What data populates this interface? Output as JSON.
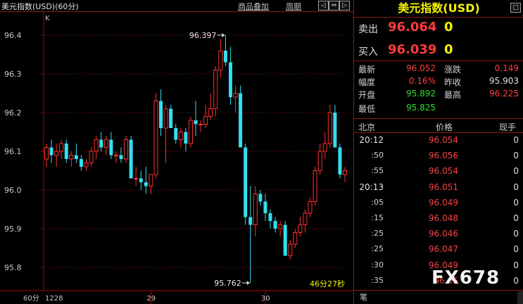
{
  "header": {
    "title": "美元指数(USD)(60分)",
    "tools": [
      "商品叠加",
      "周期"
    ],
    "nav_icons": [
      "arrow-left-icon",
      "arrows-expand-icon",
      "arrow-right-icon",
      "window-icon"
    ]
  },
  "chart": {
    "corner_label": "K",
    "period_label": "60分",
    "y_ticks": [
      "96.4",
      "96.3",
      "96.2",
      "96.1",
      "96.0",
      "95.9",
      "95.8"
    ],
    "x_ticks": [
      "1228",
      "29",
      "30"
    ],
    "high_annotation": "96.397",
    "low_annotation": "95.762",
    "countdown": "46分27秒",
    "colors": {
      "up": "#ff3030",
      "down": "#30e0f0",
      "grid": "#7a0d0d",
      "axis": "#b00000"
    }
  },
  "chart_data": {
    "type": "candlestick",
    "y_range": [
      95.74,
      96.46
    ],
    "x_tick_positions": [
      "1228",
      "29",
      "30"
    ],
    "candles": [
      {
        "o": 96.08,
        "h": 96.12,
        "l": 96.06,
        "c": 96.11
      },
      {
        "o": 96.11,
        "h": 96.13,
        "l": 96.07,
        "c": 96.09
      },
      {
        "o": 96.09,
        "h": 96.12,
        "l": 96.06,
        "c": 96.1
      },
      {
        "o": 96.1,
        "h": 96.13,
        "l": 96.08,
        "c": 96.12
      },
      {
        "o": 96.12,
        "h": 96.13,
        "l": 96.07,
        "c": 96.08
      },
      {
        "o": 96.08,
        "h": 96.1,
        "l": 96.06,
        "c": 96.09
      },
      {
        "o": 96.09,
        "h": 96.12,
        "l": 96.07,
        "c": 96.08
      },
      {
        "o": 96.08,
        "h": 96.09,
        "l": 96.05,
        "c": 96.06
      },
      {
        "o": 96.06,
        "h": 96.08,
        "l": 96.05,
        "c": 96.07
      },
      {
        "o": 96.07,
        "h": 96.11,
        "l": 96.06,
        "c": 96.1
      },
      {
        "o": 96.1,
        "h": 96.14,
        "l": 96.08,
        "c": 96.13
      },
      {
        "o": 96.13,
        "h": 96.15,
        "l": 96.1,
        "c": 96.11
      },
      {
        "o": 96.11,
        "h": 96.14,
        "l": 96.09,
        "c": 96.13
      },
      {
        "o": 96.13,
        "h": 96.15,
        "l": 96.08,
        "c": 96.09
      },
      {
        "o": 96.09,
        "h": 96.1,
        "l": 96.07,
        "c": 96.09
      },
      {
        "o": 96.09,
        "h": 96.11,
        "l": 96.07,
        "c": 96.08
      },
      {
        "o": 96.08,
        "h": 96.14,
        "l": 96.07,
        "c": 96.13
      },
      {
        "o": 96.13,
        "h": 96.14,
        "l": 96.03,
        "c": 96.03
      },
      {
        "o": 96.03,
        "h": 96.06,
        "l": 96.01,
        "c": 96.03
      },
      {
        "o": 96.03,
        "h": 96.05,
        "l": 96.0,
        "c": 96.02
      },
      {
        "o": 96.02,
        "h": 96.06,
        "l": 95.99,
        "c": 96.01
      },
      {
        "o": 96.01,
        "h": 96.04,
        "l": 95.99,
        "c": 96.04
      },
      {
        "o": 96.04,
        "h": 96.25,
        "l": 96.03,
        "c": 96.23
      },
      {
        "o": 96.23,
        "h": 96.26,
        "l": 96.14,
        "c": 96.16
      },
      {
        "o": 96.16,
        "h": 96.22,
        "l": 96.07,
        "c": 96.21
      },
      {
        "o": 96.21,
        "h": 96.22,
        "l": 96.16,
        "c": 96.16
      },
      {
        "o": 96.16,
        "h": 96.17,
        "l": 96.12,
        "c": 96.13
      },
      {
        "o": 96.13,
        "h": 96.16,
        "l": 96.11,
        "c": 96.15
      },
      {
        "o": 96.15,
        "h": 96.16,
        "l": 96.1,
        "c": 96.12
      },
      {
        "o": 96.12,
        "h": 96.19,
        "l": 96.11,
        "c": 96.18
      },
      {
        "o": 96.18,
        "h": 96.23,
        "l": 96.14,
        "c": 96.17
      },
      {
        "o": 96.17,
        "h": 96.18,
        "l": 96.15,
        "c": 96.17
      },
      {
        "o": 96.17,
        "h": 96.22,
        "l": 96.16,
        "c": 96.19
      },
      {
        "o": 96.19,
        "h": 96.25,
        "l": 96.18,
        "c": 96.21
      },
      {
        "o": 96.21,
        "h": 96.32,
        "l": 96.19,
        "c": 96.31
      },
      {
        "o": 96.31,
        "h": 96.39,
        "l": 96.29,
        "c": 96.36
      },
      {
        "o": 96.36,
        "h": 96.4,
        "l": 96.32,
        "c": 96.33
      },
      {
        "o": 96.33,
        "h": 96.37,
        "l": 96.22,
        "c": 96.24
      },
      {
        "o": 96.24,
        "h": 96.27,
        "l": 96.2,
        "c": 96.25
      },
      {
        "o": 96.25,
        "h": 96.27,
        "l": 96.11,
        "c": 96.11
      },
      {
        "o": 96.11,
        "h": 96.12,
        "l": 95.91,
        "c": 95.93
      },
      {
        "o": 95.93,
        "h": 96.01,
        "l": 95.76,
        "c": 95.91
      },
      {
        "o": 95.91,
        "h": 96.01,
        "l": 95.88,
        "c": 95.99
      },
      {
        "o": 95.99,
        "h": 96.0,
        "l": 95.96,
        "c": 95.97
      },
      {
        "o": 95.97,
        "h": 95.99,
        "l": 95.92,
        "c": 95.94
      },
      {
        "o": 95.94,
        "h": 95.95,
        "l": 95.9,
        "c": 95.92
      },
      {
        "o": 95.92,
        "h": 95.93,
        "l": 95.89,
        "c": 95.9
      },
      {
        "o": 95.9,
        "h": 95.92,
        "l": 95.88,
        "c": 95.91
      },
      {
        "o": 95.91,
        "h": 95.92,
        "l": 95.83,
        "c": 95.83
      },
      {
        "o": 95.83,
        "h": 95.87,
        "l": 95.82,
        "c": 95.86
      },
      {
        "o": 95.86,
        "h": 95.9,
        "l": 95.85,
        "c": 95.89
      },
      {
        "o": 95.89,
        "h": 95.93,
        "l": 95.88,
        "c": 95.91
      },
      {
        "o": 95.91,
        "h": 95.95,
        "l": 95.89,
        "c": 95.94
      },
      {
        "o": 95.94,
        "h": 95.98,
        "l": 95.93,
        "c": 95.97
      },
      {
        "o": 95.97,
        "h": 96.06,
        "l": 95.96,
        "c": 96.05
      },
      {
        "o": 96.05,
        "h": 96.12,
        "l": 96.04,
        "c": 96.1
      },
      {
        "o": 96.1,
        "h": 96.15,
        "l": 96.08,
        "c": 96.12
      },
      {
        "o": 96.12,
        "h": 96.22,
        "l": 96.11,
        "c": 96.2
      },
      {
        "o": 96.2,
        "h": 96.22,
        "l": 96.11,
        "c": 96.11
      },
      {
        "o": 96.11,
        "h": 96.12,
        "l": 96.03,
        "c": 96.04
      },
      {
        "o": 96.04,
        "h": 96.06,
        "l": 96.02,
        "c": 96.05
      }
    ]
  },
  "panel": {
    "title": "美元指数(USD)",
    "sell_label": "卖出",
    "sell_price": "96.064",
    "sell_vol": "0",
    "buy_label": "买入",
    "buy_price": "96.039",
    "buy_vol": "0",
    "stats": [
      {
        "label": "最新",
        "value": "96.052",
        "color": "#ff4040"
      },
      {
        "label": "涨跌",
        "value": "0.149",
        "color": "#ff4040"
      },
      {
        "label": "幅度",
        "value": "0.16%",
        "color": "#ff4040"
      },
      {
        "label": "昨收",
        "value": "95.903",
        "color": "#e0e0e0"
      },
      {
        "label": "开盘",
        "value": "95.892",
        "color": "#30e030"
      },
      {
        "label": "最高",
        "value": "96.225",
        "color": "#ff4040"
      },
      {
        "label": "最低",
        "value": "95.825",
        "color": "#30e030"
      }
    ],
    "tick_headers": [
      "北京",
      "价格",
      "现手"
    ],
    "ticks": [
      {
        "time": "20:12",
        "price": "96.054",
        "vol": "0",
        "major": true
      },
      {
        "time": ":50",
        "price": "96.056",
        "vol": "0",
        "major": false
      },
      {
        "time": ":55",
        "price": "96.054",
        "vol": "0",
        "major": false
      },
      {
        "time": "20:13",
        "price": "96.051",
        "vol": "0",
        "major": true
      },
      {
        "time": ":05",
        "price": "96.049",
        "vol": "0",
        "major": false
      },
      {
        "time": ":15",
        "price": "96.048",
        "vol": "0",
        "major": false
      },
      {
        "time": ":25",
        "price": "96.046",
        "vol": "0",
        "major": false
      },
      {
        "time": ":25",
        "price": "96.047",
        "vol": "0",
        "major": false
      },
      {
        "time": ":30",
        "price": "96.049",
        "vol": "0",
        "major": false
      },
      {
        "time": ":35",
        "price": "96.05",
        "vol": "0",
        "major": false
      }
    ],
    "bottom_tab": "笔",
    "watermark": "FX678"
  }
}
